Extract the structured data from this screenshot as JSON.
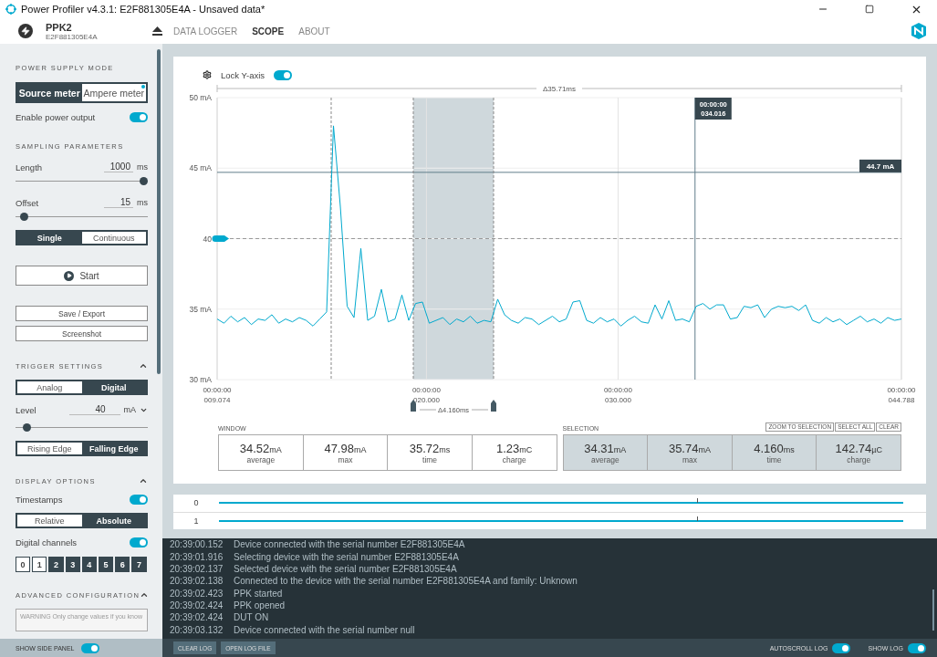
{
  "window": {
    "title": "Power Profiler v4.3.1: E2F881305E4A - Unsaved data*"
  },
  "device": {
    "name": "PPK2",
    "serial": "E2F881305E4A"
  },
  "nav_tabs": [
    {
      "label": "DATA LOGGER",
      "selected": false
    },
    {
      "label": "SCOPE",
      "selected": true
    },
    {
      "label": "ABOUT",
      "selected": false
    }
  ],
  "sidebar": {
    "power_supply": {
      "heading": "POWER SUPPLY MODE",
      "options": [
        {
          "label": "Source meter",
          "selected": false,
          "indicator": false
        },
        {
          "label": "Ampere meter",
          "selected": true,
          "indicator": true
        }
      ],
      "enable_output": {
        "label": "Enable power output",
        "on": true
      }
    },
    "sampling": {
      "heading": "SAMPLING PARAMETERS",
      "fields": [
        {
          "label": "Length",
          "value": "1000",
          "unit": "ms",
          "level": 1
        },
        {
          "label": "Offset",
          "value": "15",
          "unit": "ms",
          "level": 0.04
        }
      ],
      "modes": [
        {
          "label": "Single",
          "selected": false
        },
        {
          "label": "Continuous",
          "selected": true
        }
      ],
      "start_button": "Start",
      "buttons": [
        "Save / Export",
        "Screenshot"
      ]
    },
    "trigger": {
      "heading": "TRIGGER SETTINGS",
      "expanded": true,
      "types": [
        {
          "label": "Analog",
          "selected": true
        },
        {
          "label": "Digital",
          "selected": false
        }
      ],
      "level": {
        "label": "Level",
        "value": "40",
        "unit": "mA",
        "level": 0.06
      },
      "edges": [
        {
          "label": "Rising Edge",
          "selected": true
        },
        {
          "label": "Falling Edge",
          "selected": false
        }
      ]
    },
    "display": {
      "heading": "DISPLAY OPTIONS",
      "expanded": true,
      "timestamps": {
        "label": "Timestamps",
        "on": true
      },
      "timestamp_modes": [
        {
          "label": "Relative",
          "selected": true
        },
        {
          "label": "Absolute",
          "selected": false
        }
      ],
      "digital_channels": {
        "label": "Digital channels",
        "on": true
      },
      "channels": [
        {
          "label": "0",
          "selected": true
        },
        {
          "label": "1",
          "selected": true
        },
        {
          "label": "2",
          "selected": false
        },
        {
          "label": "3",
          "selected": false
        },
        {
          "label": "4",
          "selected": false
        },
        {
          "label": "5",
          "selected": false
        },
        {
          "label": "6",
          "selected": false
        },
        {
          "label": "7",
          "selected": false
        }
      ]
    },
    "advanced": {
      "heading": "ADVANCED CONFIGURATION",
      "expanded": true,
      "warning": "WARNING Only change values if you know"
    }
  },
  "chart": {
    "lock_y_axis": {
      "label": "Lock Y-axis",
      "on": true
    },
    "total_delta": "Δ35.71ms",
    "chart_data": {
      "type": "line",
      "grid": true,
      "ref_lines": [
        {
          "axis": "y",
          "value": 44.7,
          "label": "44.7 mA"
        },
        {
          "axis": "y",
          "value": 40
        },
        {
          "axis": "x",
          "value": 15.026
        },
        {
          "axis": "x",
          "value": 19.312
        },
        {
          "axis": "x",
          "value": 23.503
        },
        {
          "axis": "x",
          "value": 34.016,
          "label": "034.016"
        }
      ],
      "bands": [
        {
          "axis": "x",
          "from": 19.312,
          "to": 23.503
        }
      ],
      "x": [
        9.074,
        9.431,
        9.788,
        10.145,
        10.503,
        10.86,
        11.217,
        11.574,
        11.931,
        12.288,
        12.645,
        13.002,
        13.359,
        13.716,
        14.074,
        14.431,
        14.788,
        15.145,
        15.502,
        15.859,
        16.217,
        16.574,
        16.931,
        17.288,
        17.646,
        18.003,
        18.36,
        18.717,
        19.074,
        19.431,
        19.788,
        20.145,
        20.502,
        20.859,
        21.217,
        21.574,
        21.931,
        22.288,
        22.645,
        23.002,
        23.36,
        23.717,
        24.074,
        24.431,
        24.789,
        25.146,
        25.503,
        25.86,
        26.217,
        26.574,
        26.931,
        27.288,
        27.645,
        28.002,
        28.36,
        28.717,
        29.074,
        29.431,
        29.788,
        30.145,
        30.502,
        30.859,
        31.216,
        31.573,
        31.931,
        32.288,
        32.645,
        33.002,
        33.359,
        33.716,
        34.074,
        34.431,
        34.788,
        35.145,
        35.503,
        35.86,
        36.217,
        36.574,
        36.931,
        37.288,
        37.645,
        38.002,
        38.359,
        38.716,
        39.074,
        39.431,
        39.788,
        40.145,
        40.502,
        40.859,
        41.217,
        41.574,
        41.931,
        42.288,
        42.646,
        43.003,
        43.36,
        43.717,
        44.074,
        44.431,
        44.788
      ],
      "xlim": [
        9.074,
        44.788
      ],
      "ylim": [
        30,
        50
      ],
      "xticks": [
        {
          "value": 9.074,
          "label": "009.074"
        },
        {
          "value": 20,
          "label": "020.000"
        },
        {
          "value": 30,
          "label": "030.000"
        },
        {
          "value": 44.788,
          "label": "044.788"
        }
      ],
      "yticks": [
        {
          "value": 50,
          "label": "50 mA"
        },
        {
          "value": 45,
          "label": "45 mA"
        },
        {
          "value": 40,
          "label": "40"
        },
        {
          "value": 35,
          "label": "35 mA"
        },
        {
          "value": 30,
          "label": "30 mA"
        }
      ],
      "series": [
        {
          "color": "#00a9ce",
          "values": [
            34.3,
            34.0,
            34.5,
            34.1,
            34.4,
            33.9,
            34.3,
            34.2,
            34.6,
            34.0,
            34.3,
            34.1,
            34.4,
            34.2,
            33.8,
            34.3,
            34.8,
            48.0,
            42.3,
            35.2,
            34.4,
            39.3,
            34.2,
            34.5,
            36.4,
            34.1,
            34.3,
            36.0,
            34.2,
            35.4,
            35.5,
            34.0,
            34.2,
            34.4,
            33.9,
            34.3,
            34.1,
            34.5,
            34.0,
            34.2,
            34.1,
            35.7,
            34.6,
            34.2,
            34.0,
            34.4,
            34.3,
            33.9,
            34.2,
            34.5,
            34.1,
            34.3,
            35.5,
            35.6,
            34.2,
            34.0,
            34.4,
            34.1,
            34.3,
            33.8,
            34.2,
            34.5,
            34.1,
            34.0,
            35.3,
            34.3,
            35.6,
            34.2,
            34.3,
            34.1,
            35.2,
            35.4,
            35.0,
            35.3,
            35.3,
            34.3,
            34.4,
            35.2,
            35.1,
            35.3,
            34.4,
            35.0,
            35.2,
            35.1,
            35.2,
            34.9,
            35.3,
            34.2,
            34.0,
            34.4,
            34.1,
            34.3,
            33.9,
            34.2,
            34.5,
            34.1,
            34.3,
            34.0,
            34.4,
            34.2,
            34.3
          ]
        }
      ]
    },
    "x_tick_times": [
      "00:00:00",
      "00:00:00",
      "00:00:00",
      "00:00:00"
    ],
    "cursor_time": "00:00:00",
    "selection_delta": "Δ4.160ms"
  },
  "stats": {
    "window": {
      "heading": "WINDOW",
      "items": [
        {
          "value": "34.52",
          "unit": "mA",
          "label": "average"
        },
        {
          "value": "47.98",
          "unit": "mA",
          "label": "max"
        },
        {
          "value": "35.72",
          "unit": "ms",
          "label": "time"
        },
        {
          "value": "1.23",
          "unit": "mC",
          "label": "charge"
        }
      ]
    },
    "selection": {
      "heading": "SELECTION",
      "actions": [
        "ZOOM TO SELECTION",
        "SELECT ALL",
        "CLEAR"
      ],
      "items": [
        {
          "value": "34.31",
          "unit": "mA",
          "label": "average"
        },
        {
          "value": "35.74",
          "unit": "mA",
          "label": "max"
        },
        {
          "value": "4.160",
          "unit": "ms",
          "label": "time"
        },
        {
          "value": "142.74",
          "unit": "µC",
          "label": "charge"
        }
      ]
    }
  },
  "digital_rows": [
    "0",
    "1"
  ],
  "log": {
    "entries": [
      {
        "time": "20:39:00.152",
        "message": "Device connected with the serial number E2F881305E4A"
      },
      {
        "time": "20:39:01.916",
        "message": "Selecting device with the serial number E2F881305E4A"
      },
      {
        "time": "20:39:02.137",
        "message": "Selected device with the serial number E2F881305E4A"
      },
      {
        "time": "20:39:02.138",
        "message": "Connected to the device with the serial number E2F881305E4A and family: Unknown"
      },
      {
        "time": "20:39:02.423",
        "message": "PPK started"
      },
      {
        "time": "20:39:02.424",
        "message": "PPK opened"
      },
      {
        "time": "20:39:02.424",
        "message": "DUT ON"
      },
      {
        "time": "20:39:03.132",
        "message": "Device connected with the serial number null"
      }
    ],
    "buttons": [
      "CLEAR LOG",
      "OPEN LOG FILE"
    ],
    "toggles": [
      {
        "label": "AUTOSCROLL LOG",
        "on": true
      },
      {
        "label": "SHOW LOG",
        "on": true
      }
    ]
  },
  "side_panel_toggle": {
    "label": "SHOW SIDE PANEL",
    "on": true
  }
}
